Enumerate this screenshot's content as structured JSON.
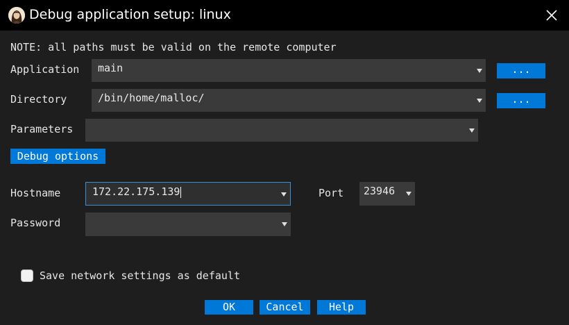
{
  "window": {
    "title": "Debug application setup: linux",
    "app_icon": "portrait-icon",
    "close_icon": "close-icon"
  },
  "note": "NOTE: all paths must be valid on the remote computer",
  "fields": {
    "application": {
      "label": "Application",
      "value": "main",
      "browse_label": "..."
    },
    "directory": {
      "label": "Directory",
      "value": "/bin/home/malloc/",
      "browse_label": "..."
    },
    "parameters": {
      "label": "Parameters",
      "value": ""
    }
  },
  "debug_options_label": "Debug options",
  "network": {
    "hostname": {
      "label": "Hostname",
      "value": "172.22.175.139"
    },
    "port": {
      "label": "Port",
      "value": "23946"
    },
    "password": {
      "label": "Password",
      "value": ""
    }
  },
  "save_default": {
    "label": "Save network settings as default",
    "checked": false
  },
  "buttons": {
    "ok": "OK",
    "cancel": "Cancel",
    "help": "Help"
  },
  "colors": {
    "background": "#1e1e1e",
    "titlebar": "#000000",
    "accent": "#0078d7",
    "field": "#3a3a3a",
    "focus_border": "#3a90d8"
  }
}
